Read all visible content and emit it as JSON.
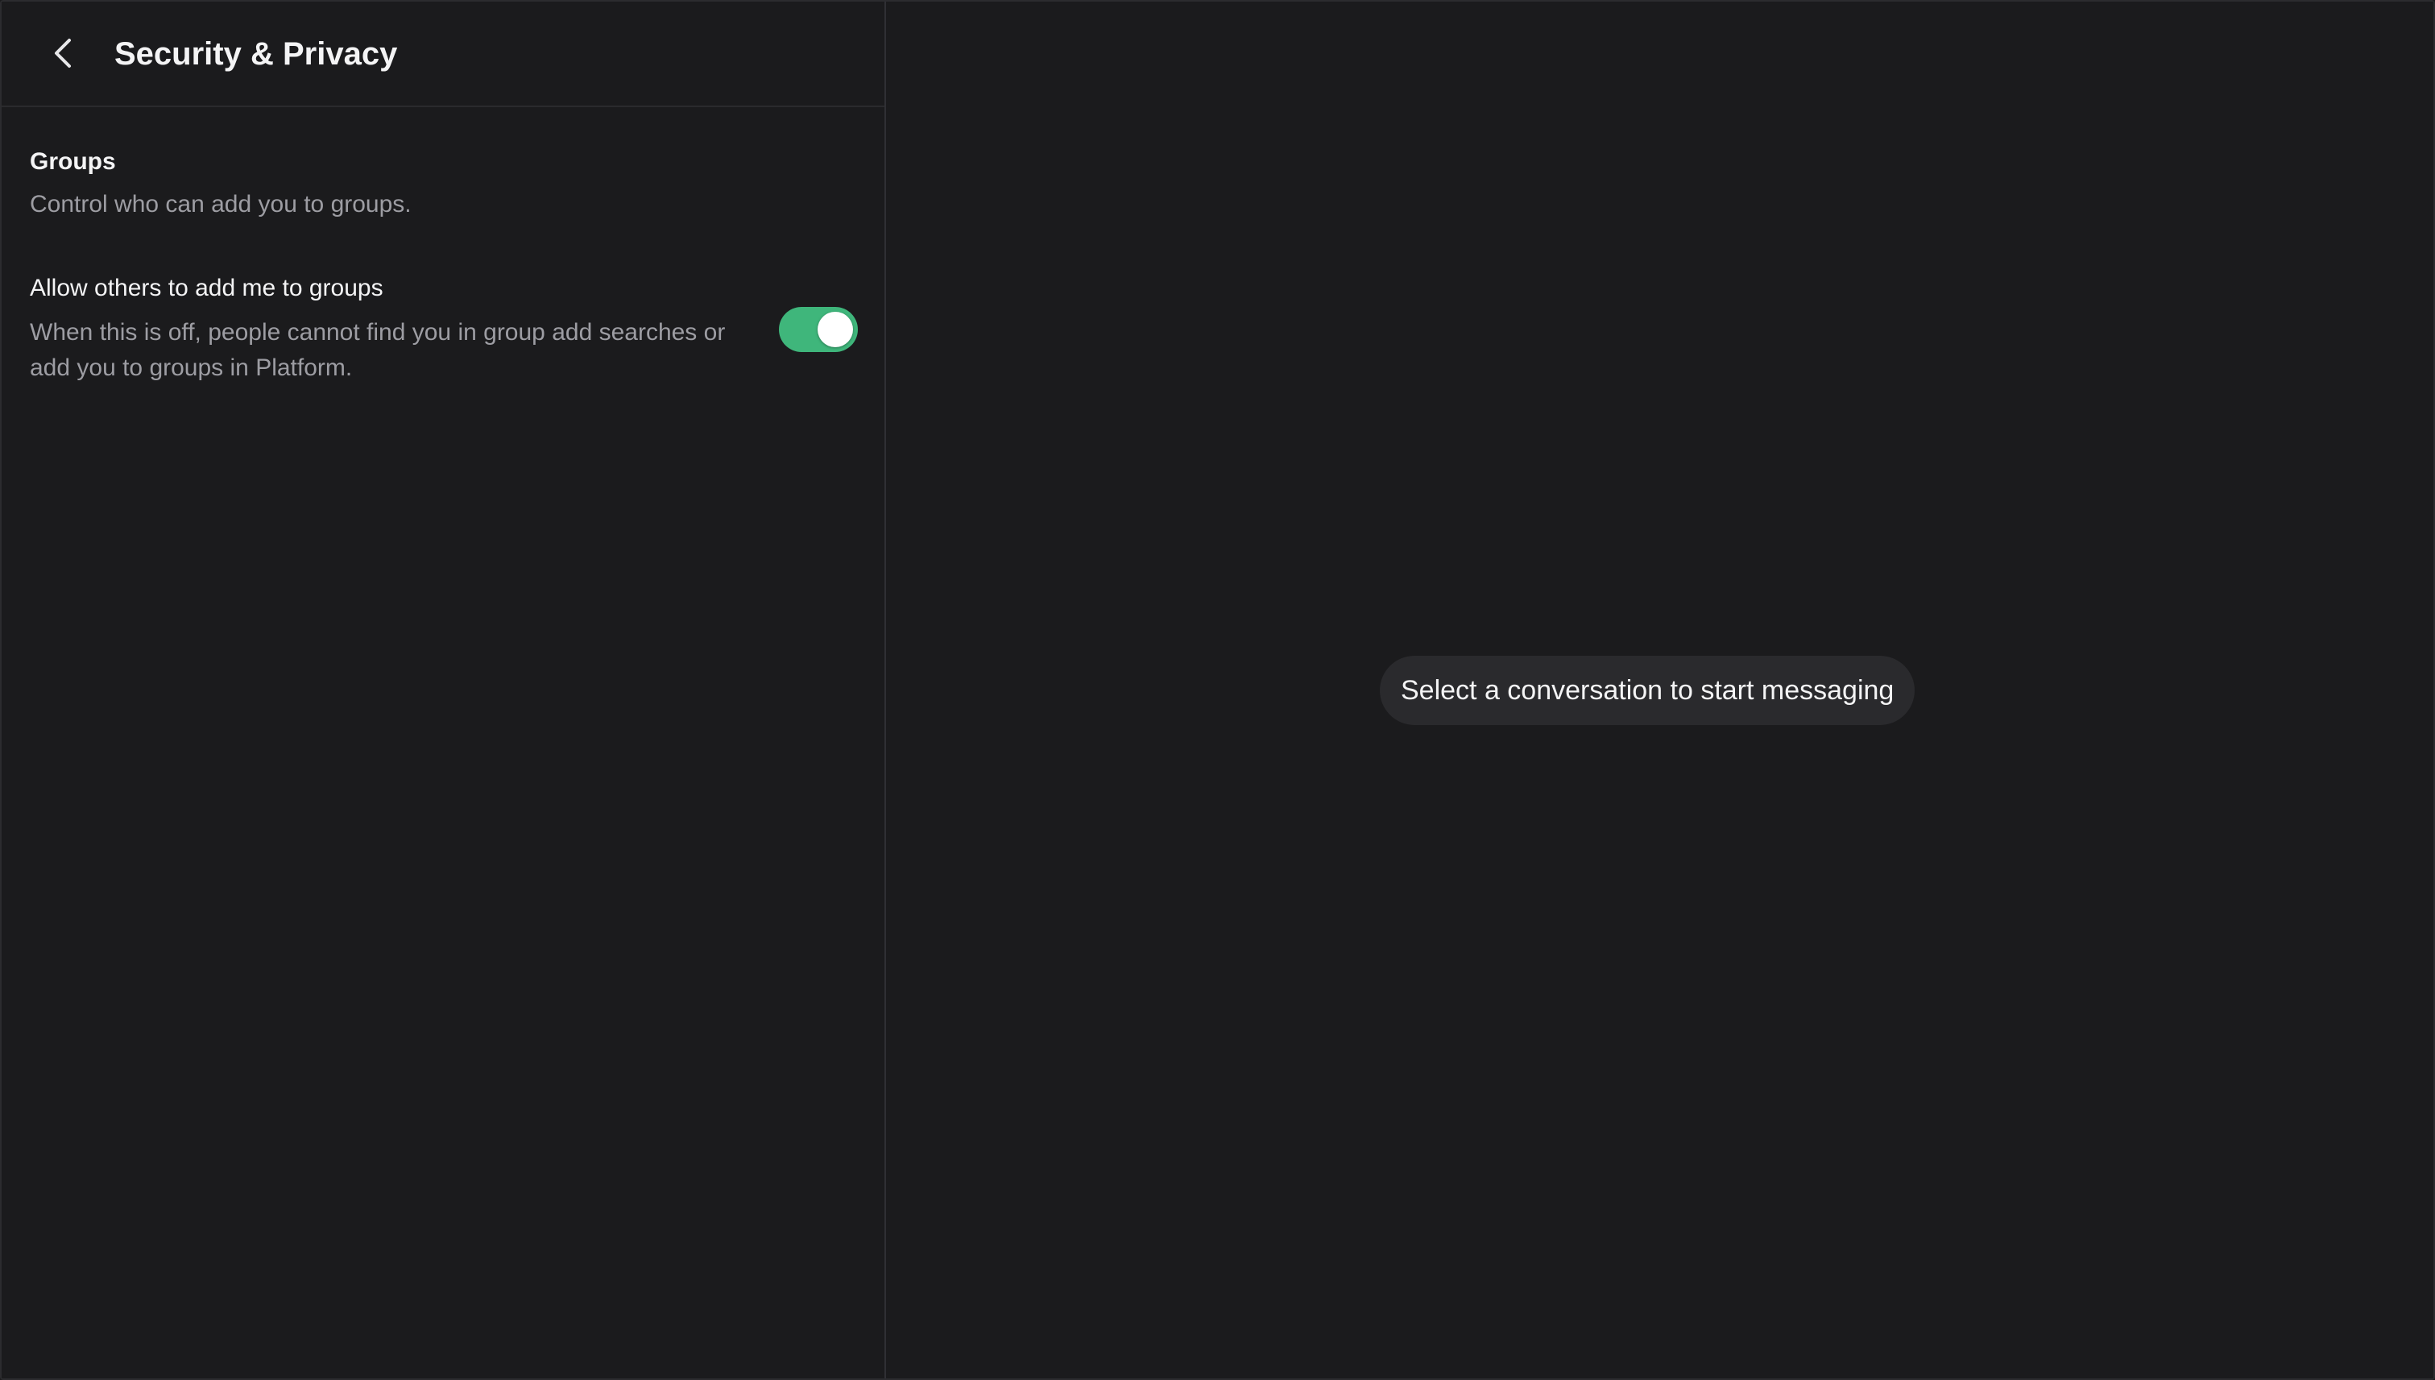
{
  "header": {
    "title": "Security & Privacy",
    "back_icon": "chevron-left-icon"
  },
  "groups_section": {
    "title": "Groups",
    "description": "Control who can add you to groups."
  },
  "allow_add_setting": {
    "label": "Allow others to add me to groups",
    "description": "When this is off, people cannot find you in group add searches or add you to groups in Platform.",
    "enabled": true
  },
  "main": {
    "empty_state": "Select a conversation to start messaging"
  },
  "colors": {
    "background": "#1b1b1d",
    "toggle_on": "#3fb67b",
    "muted_text": "#9d9da3",
    "pill_background": "#2a2a2d"
  }
}
